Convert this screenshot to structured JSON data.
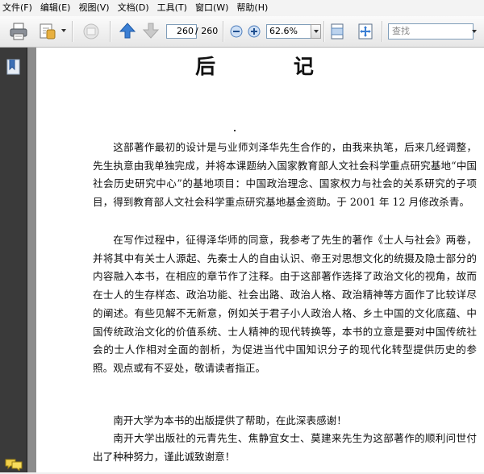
{
  "menu": [
    "文件(F)",
    "编辑(E)",
    "视图(V)",
    "文档(D)",
    "工具(T)",
    "窗口(W)",
    "帮助(H)"
  ],
  "toolbar": {
    "page_current": "260",
    "page_total": "/ 260",
    "zoom": "62.6%",
    "search_placeholder": "查找"
  },
  "document": {
    "title": "后 记",
    "paragraphs": [
      "这部著作最初的设计是与业师刘泽华先生合作的，由我来执笔，后来几经调整，先生执意由我单独完成，并将本课题纳入国家教育部人文社会科学重点研究基地“中国社会历史研究中心”的基地项目：中国政治理念、国家权力与社会的关系研究的子项目，得到教育部人文社会科学重点研究基地基金资助。于 2001 年 12 月修改杀青。",
      "在写作过程中，征得泽华师的同意，我参考了先生的著作《士人与社会》两卷，并将其中有关士人源起、先秦士人的自由认识、帝王对思想文化的统摄及隐士部分的内容融入本书，在相应的章节作了注释。由于这部著作选择了政治文化的视角，故而在士人的生存样态、政治功能、社会出路、政治人格、政治精神等方面作了比较详尽的阐述。有些见解不无新意，例如关于君子小人政治人格、乡土中国的文化底蕴、中国传统政治文化的价值系统、士人精神的现代转换等，本书的立意是要对中国传统社会的士人作相对全面的剖析，为促进当代中国知识分子的现代化转型提供历史的参照。观点或有不妥处，敬请读者指正。",
      "南开大学为本书的出版提供了帮助，在此深表感谢！",
      "南开大学出版社的元青先生、焦静宜女士、莫建来先生为这部著作的顺利问世付出了种种努力，谨此诚致谢意！"
    ]
  },
  "icons": {
    "print": "printer-icon",
    "attach": "attach-icon",
    "review": "review-icon",
    "prev": "up-arrow-icon",
    "next": "down-arrow-icon",
    "zoom_out": "zoom-out-icon",
    "zoom_in": "zoom-in-icon",
    "fit_width": "fit-width-icon",
    "fit_page": "fit-page-icon",
    "bookmarks": "bookmark-icon",
    "comments": "comment-icon"
  },
  "colors": {
    "sidebar": "#3a3a3a",
    "canvas": "#8c8c8c",
    "accent_blue": "#2b6fc4"
  }
}
